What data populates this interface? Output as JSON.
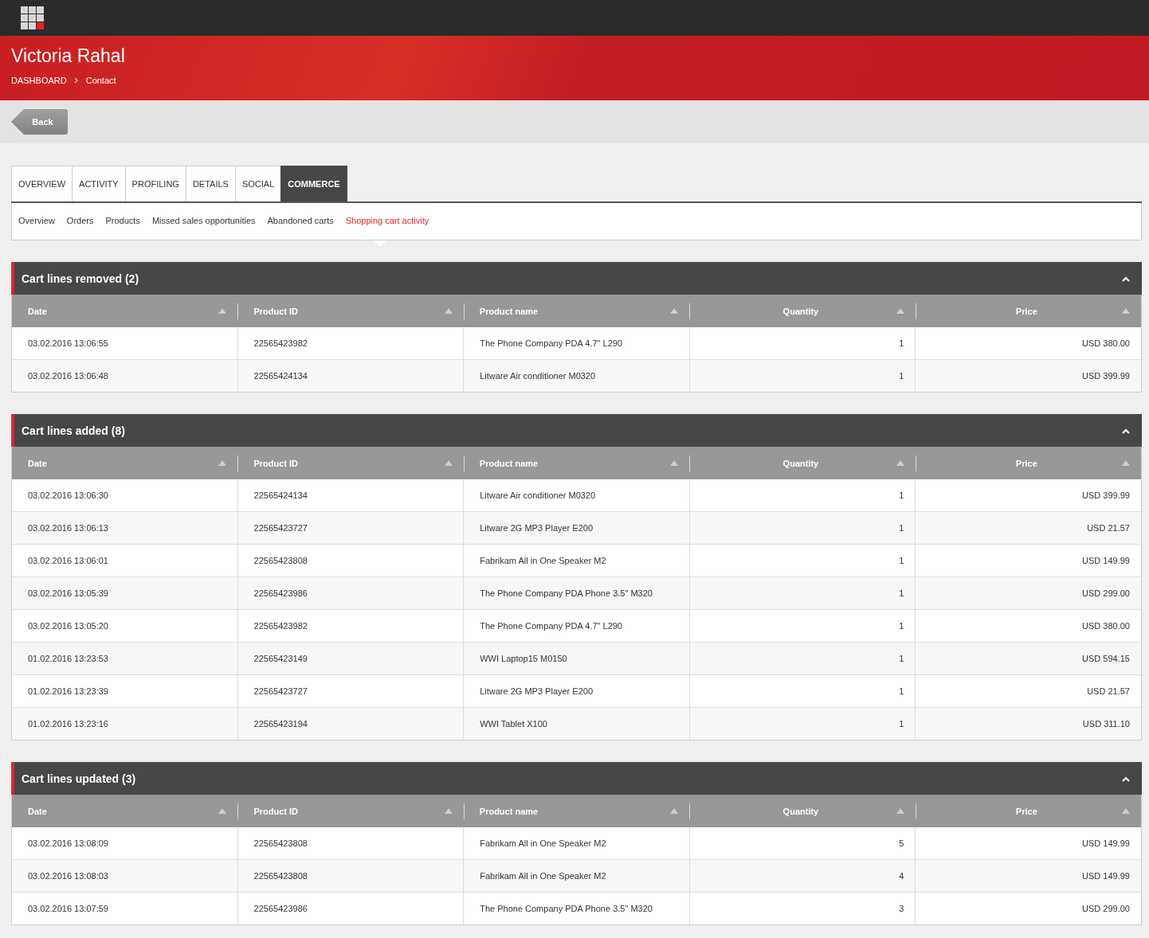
{
  "header": {
    "title": "Victoria Rahal",
    "breadcrumbs": [
      "DASHBOARD",
      "Contact"
    ]
  },
  "back_button": "Back",
  "tabs": [
    {
      "label": "OVERVIEW",
      "selected": false
    },
    {
      "label": "ACTIVITY",
      "selected": false
    },
    {
      "label": "PROFILING",
      "selected": false
    },
    {
      "label": "DETAILS",
      "selected": false
    },
    {
      "label": "SOCIAL",
      "selected": false
    },
    {
      "label": "COMMERCE",
      "selected": true
    }
  ],
  "subtabs": [
    {
      "label": "Overview",
      "selected": false
    },
    {
      "label": "Orders",
      "selected": false
    },
    {
      "label": "Products",
      "selected": false
    },
    {
      "label": "Missed sales opportunities",
      "selected": false
    },
    {
      "label": "Abandoned carts",
      "selected": false
    },
    {
      "label": "Shopping cart activity",
      "selected": true
    }
  ],
  "panels": [
    {
      "title": "Cart lines removed (2)",
      "expanded": true,
      "columns": [
        "Date",
        "Product ID",
        "Product name",
        "Quantity",
        "Price"
      ],
      "rows": [
        [
          "03.02.2016 13:06:55",
          "22565423982",
          "The Phone Company PDA 4.7\" L290",
          "1",
          "USD 380.00"
        ],
        [
          "03.02.2016 13:06:48",
          "22565424134",
          "Litware Air conditioner M0320",
          "1",
          "USD 399.99"
        ]
      ]
    },
    {
      "title": "Cart lines added (8)",
      "expanded": true,
      "columns": [
        "Date",
        "Product ID",
        "Product name",
        "Quantity",
        "Price"
      ],
      "rows": [
        [
          "03.02.2016 13:06:30",
          "22565424134",
          "Litware Air conditioner M0320",
          "1",
          "USD 399.99"
        ],
        [
          "03.02.2016 13:06:13",
          "22565423727",
          "Litware 2G MP3 Player E200",
          "1",
          "USD 21.57"
        ],
        [
          "03.02.2016 13:06:01",
          "22565423808",
          "Fabrikam All in One Speaker M2",
          "1",
          "USD 149.99"
        ],
        [
          "03.02.2016 13:05:39",
          "22565423986",
          "The Phone Company PDA Phone 3.5\" M320",
          "1",
          "USD 299.00"
        ],
        [
          "03.02.2016 13:05:20",
          "22565423982",
          "The Phone Company PDA 4.7\" L290",
          "1",
          "USD 380.00"
        ],
        [
          "01.02.2016 13:23:53",
          "22565423149",
          "WWI Laptop15 M0150",
          "1",
          "USD 594.15"
        ],
        [
          "01.02.2016 13:23:39",
          "22565423727",
          "Litware 2G MP3 Player E200",
          "1",
          "USD 21.57"
        ],
        [
          "01.02.2016 13:23:16",
          "22565423194",
          "WWI Tablet X100",
          "1",
          "USD 311.10"
        ]
      ]
    },
    {
      "title": "Cart lines updated (3)",
      "expanded": true,
      "columns": [
        "Date",
        "Product ID",
        "Product name",
        "Quantity",
        "Price"
      ],
      "rows": [
        [
          "03.02.2016 13:08:09",
          "22565423808",
          "Fabrikam All in One Speaker M2",
          "5",
          "USD 149.99"
        ],
        [
          "03.02.2016 13:08:03",
          "22565423808",
          "Fabrikam All in One Speaker M2",
          "4",
          "USD 149.99"
        ],
        [
          "03.02.2016 13:07:59",
          "22565423986",
          "The Phone Company PDA Phone 3.5\" M320",
          "3",
          "USD 299.00"
        ]
      ]
    }
  ]
}
